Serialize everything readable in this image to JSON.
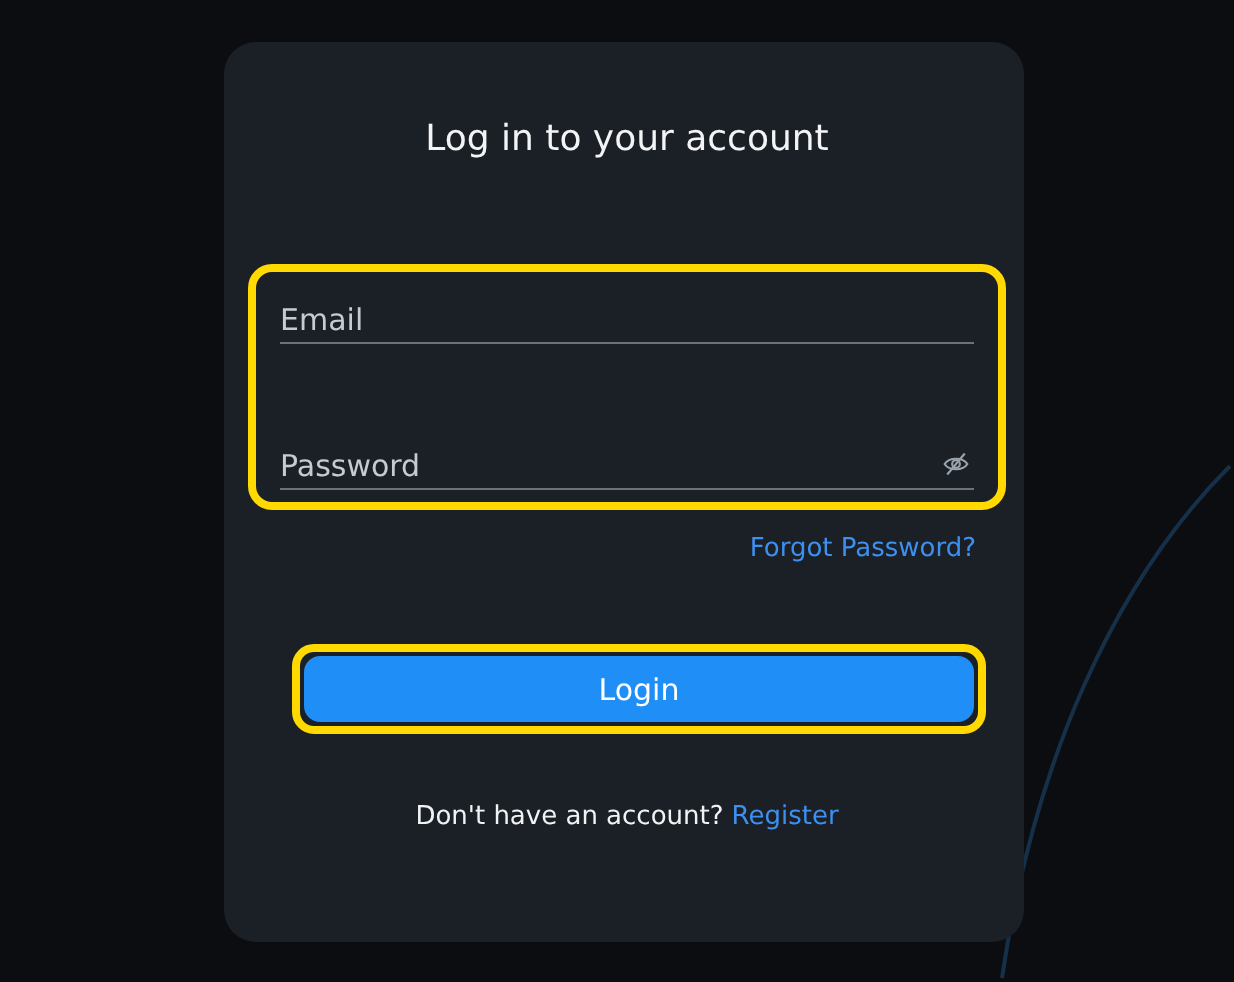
{
  "title": "Log in to your account",
  "credentials": {
    "highlighted": true,
    "fields": [
      {
        "kind": "text",
        "placeholder": "Email"
      },
      {
        "kind": "password",
        "placeholder": "Password"
      }
    ]
  },
  "forgot_link": "Forgot Password?",
  "login_button": {
    "label": "Login",
    "highlighted": true
  },
  "register_prompt": {
    "text": "Don't have an account?",
    "link": "Register"
  }
}
